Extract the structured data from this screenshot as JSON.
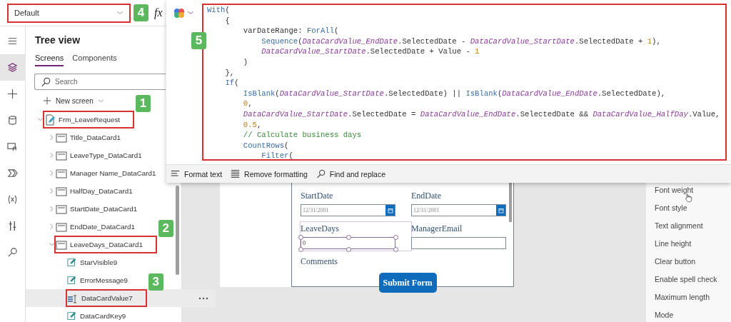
{
  "formula_bar": {
    "property": {
      "value": "Default",
      "highlighted": true,
      "callout": "4"
    },
    "fx_label": "fx"
  },
  "rail": [
    {
      "selected": false
    },
    {
      "selected": true
    },
    {
      "selected": false
    },
    {
      "selected": false
    },
    {
      "selected": false
    },
    {
      "selected": false
    },
    {
      "selected": false
    },
    {
      "selected": false
    },
    {
      "selected": false
    }
  ],
  "tree_view": {
    "title": "Tree view",
    "tabs": [
      {
        "label": "Screens",
        "selected": true
      },
      {
        "label": "Components",
        "selected": false
      }
    ],
    "search": {
      "placeholder": "Search"
    },
    "new_screen": "New screen",
    "items": [
      {
        "label": "Frm_LeaveRequest",
        "kind": "form",
        "expanded": true,
        "selected": false,
        "highlighted": true,
        "callout": "1",
        "children": [
          {
            "label": "Title_DataCard1",
            "kind": "card",
            "expanded": false,
            "selected": false,
            "highlighted": false
          },
          {
            "label": "LeaveType_DataCard1",
            "kind": "card",
            "expanded": false,
            "selected": false,
            "highlighted": false
          },
          {
            "label": "Manager Name_DataCard1",
            "kind": "card",
            "expanded": false,
            "selected": false,
            "highlighted": false
          },
          {
            "label": "HalfDay_DataCard1",
            "kind": "card",
            "expanded": false,
            "selected": false,
            "highlighted": false
          },
          {
            "label": "StartDate_DataCard1",
            "kind": "card",
            "expanded": false,
            "selected": false,
            "highlighted": false
          },
          {
            "label": "EndDate_DataCard1",
            "kind": "card",
            "expanded": false,
            "selected": false,
            "highlighted": false
          },
          {
            "label": "LeaveDays_DataCard1",
            "kind": "card",
            "expanded": true,
            "selected": false,
            "highlighted": true,
            "callout": "2",
            "children": [
              {
                "label": "StarVisible9",
                "kind": "control",
                "selected": false,
                "highlighted": false
              },
              {
                "label": "ErrorMessage9",
                "kind": "control",
                "selected": false,
                "highlighted": false
              },
              {
                "label": "DataCardValue7",
                "kind": "input",
                "selected": true,
                "highlighted": true,
                "callout": "3"
              },
              {
                "label": "DataCardKey9",
                "kind": "control",
                "selected": false,
                "highlighted": false
              }
            ]
          }
        ]
      }
    ]
  },
  "formula_editor": {
    "highlighted": true,
    "callout": "5",
    "lines": [
      {
        "tokens": [
          {
            "text": "With",
            "kind": "fn"
          },
          {
            "text": "(",
            "kind": "plain"
          }
        ]
      },
      {
        "tokens": [
          {
            "text": "    {",
            "kind": "plain"
          }
        ]
      },
      {
        "tokens": [
          {
            "text": "        varDateRange: ",
            "kind": "plain"
          },
          {
            "text": "ForAll",
            "kind": "fn"
          },
          {
            "text": "(",
            "kind": "plain"
          }
        ]
      },
      {
        "tokens": [
          {
            "text": "            Sequence",
            "kind": "fn"
          },
          {
            "text": "(",
            "kind": "plain"
          },
          {
            "text": "DataCardValue_EndDate",
            "kind": "ref"
          },
          {
            "text": ".SelectedDate - ",
            "kind": "plain"
          },
          {
            "text": "DataCardValue_StartDate",
            "kind": "ref"
          },
          {
            "text": ".SelectedDate + ",
            "kind": "plain"
          },
          {
            "text": "1",
            "kind": "num"
          },
          {
            "text": "),",
            "kind": "plain"
          }
        ]
      },
      {
        "tokens": [
          {
            "text": "            DataCardValue_StartDate",
            "kind": "ref"
          },
          {
            "text": ".SelectedDate + Value - ",
            "kind": "plain"
          },
          {
            "text": "1",
            "kind": "num"
          }
        ]
      },
      {
        "tokens": [
          {
            "text": "        )",
            "kind": "plain"
          }
        ]
      },
      {
        "tokens": [
          {
            "text": "    },",
            "kind": "plain"
          }
        ]
      },
      {
        "tokens": [
          {
            "text": "    If",
            "kind": "fn"
          },
          {
            "text": "(",
            "kind": "plain"
          }
        ]
      },
      {
        "tokens": [
          {
            "text": "        IsBlank",
            "kind": "fn"
          },
          {
            "text": "(",
            "kind": "plain"
          },
          {
            "text": "DataCardValue_StartDate",
            "kind": "ref"
          },
          {
            "text": ".SelectedDate) || ",
            "kind": "plain"
          },
          {
            "text": "IsBlank",
            "kind": "fn"
          },
          {
            "text": "(",
            "kind": "plain"
          },
          {
            "text": "DataCardValue_EndDate",
            "kind": "ref"
          },
          {
            "text": ".SelectedDate),",
            "kind": "plain"
          }
        ]
      },
      {
        "tokens": [
          {
            "text": "        0",
            "kind": "num"
          },
          {
            "text": ",",
            "kind": "plain"
          }
        ]
      },
      {
        "tokens": [
          {
            "text": "        DataCardValue_StartDate",
            "kind": "ref"
          },
          {
            "text": ".SelectedDate = ",
            "kind": "plain"
          },
          {
            "text": "DataCardValue_EndDate",
            "kind": "ref"
          },
          {
            "text": ".SelectedDate && ",
            "kind": "plain"
          },
          {
            "text": "DataCardValue_HalfDay",
            "kind": "ref"
          },
          {
            "text": ".Value,",
            "kind": "plain"
          }
        ]
      },
      {
        "tokens": [
          {
            "text": "        0.5",
            "kind": "num"
          },
          {
            "text": ",",
            "kind": "plain"
          }
        ]
      },
      {
        "tokens": [
          {
            "text": "        // Calculate business days",
            "kind": "comment"
          }
        ]
      },
      {
        "tokens": [
          {
            "text": "        CountRows",
            "kind": "fn"
          },
          {
            "text": "(",
            "kind": "plain"
          }
        ]
      },
      {
        "tokens": [
          {
            "text": "            Filter",
            "kind": "fn"
          },
          {
            "text": "(",
            "kind": "plain"
          }
        ]
      }
    ],
    "toolbar": [
      {
        "label": "Format text"
      },
      {
        "label": "Remove formatting"
      },
      {
        "label": "Find and replace"
      }
    ]
  },
  "canvas": {
    "fields": [
      {
        "label": "StartDate",
        "kind": "date",
        "placeholder": "12/31/2001",
        "selected": false
      },
      {
        "label": "EndDate",
        "kind": "date",
        "placeholder": "12/31/2001",
        "selected": false
      },
      {
        "label": "LeaveDays",
        "kind": "text",
        "value": "0",
        "selected": true
      },
      {
        "label": "ManagerEmail",
        "kind": "text",
        "selected": false
      },
      {
        "label": "Comments",
        "kind": "label",
        "selected": false
      }
    ],
    "submit_button": "Submit Form"
  },
  "properties": [
    "Font weight",
    "Font style",
    "Text alignment",
    "Line height",
    "Clear button",
    "Enable spell check",
    "Maximum length",
    "Mode"
  ]
}
